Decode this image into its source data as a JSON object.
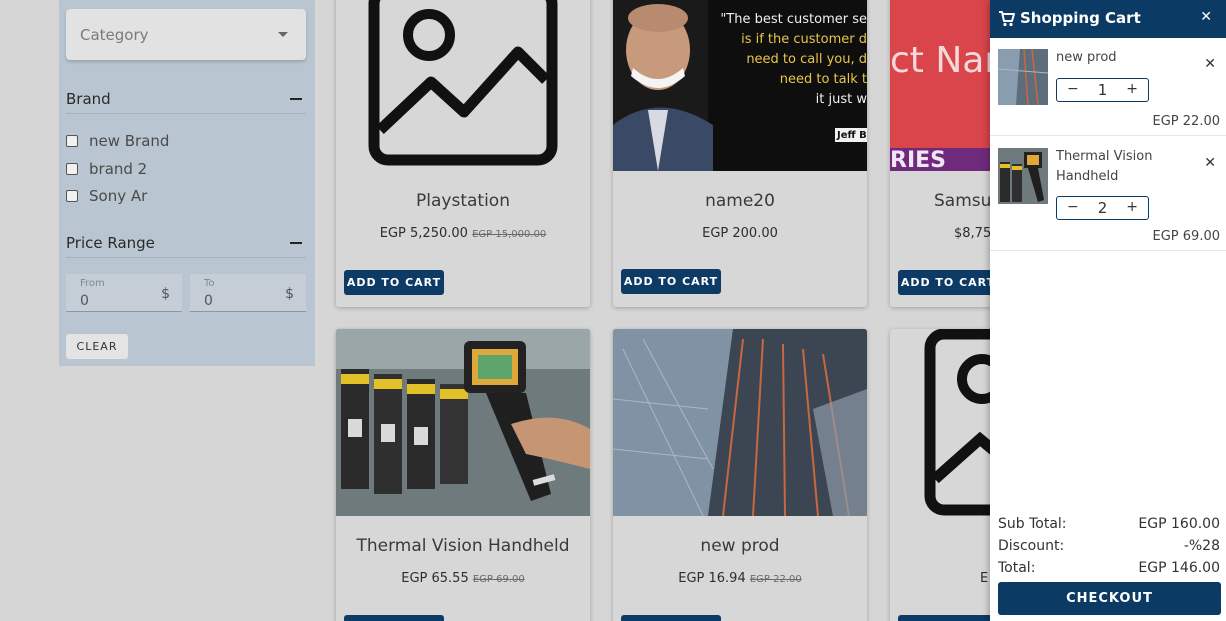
{
  "filters": {
    "category_placeholder": "Category",
    "brand_title": "Brand",
    "brands": [
      "new Brand",
      "brand 2",
      "Sony Ar"
    ],
    "price_title": "Price Range",
    "from_label": "From",
    "from_value": "0",
    "to_label": "To",
    "to_value": "0",
    "currency_symbol": "$",
    "clear_label": "CLEAR"
  },
  "products": [
    {
      "title": "Playstation",
      "price": "EGP 5,250.00",
      "old_price": "EGP 15,000.00",
      "button": "ADD TO CART",
      "image": "placeholder-image-icon"
    },
    {
      "title": "name20",
      "price": "EGP 200.00",
      "old_price": "",
      "button": "ADD TO CART",
      "image": "quote-photo"
    },
    {
      "title": "Samsu",
      "price": "$8,75",
      "old_price": "",
      "button": "ADD TO CART",
      "image": "product-name-banner",
      "banner_text": "ct Nam",
      "banner_sub": "RIES"
    },
    {
      "title": "Thermal Vision Handheld",
      "price": "EGP 65.55",
      "old_price": "EGP 69.00",
      "button": "",
      "image": "thermal-camera-photo"
    },
    {
      "title": "new prod",
      "price": "EGP 16.94",
      "old_price": "EGP 22.00",
      "button": "",
      "image": "building-photo"
    },
    {
      "title": "",
      "price": "E",
      "old_price": "",
      "button": "",
      "image": "placeholder-image-icon"
    }
  ],
  "quote": {
    "lines": [
      "\"The best customer se",
      "is if the customer d",
      "need to call you, d",
      "need to talk t",
      "it just w"
    ],
    "author": "Jeff B"
  },
  "cart": {
    "title": "Shopping Cart",
    "items": [
      {
        "name": "new prod",
        "qty": "1",
        "price": "EGP 22.00"
      },
      {
        "name": "Thermal Vision Handheld",
        "qty": "2",
        "price": "EGP 69.00"
      }
    ],
    "subtotal_label": "Sub Total:",
    "subtotal_value": "EGP 160.00",
    "discount_label": "Discount:",
    "discount_value": "-%28",
    "total_label": "Total:",
    "total_value": "EGP 146.00",
    "checkout_label": "CHECKOUT"
  },
  "colors": {
    "primary": "#0b3a65",
    "filter_bg": "#b9c6d1",
    "overlay_bg": "#d6d6d6",
    "banner_red": "#d9454b"
  }
}
